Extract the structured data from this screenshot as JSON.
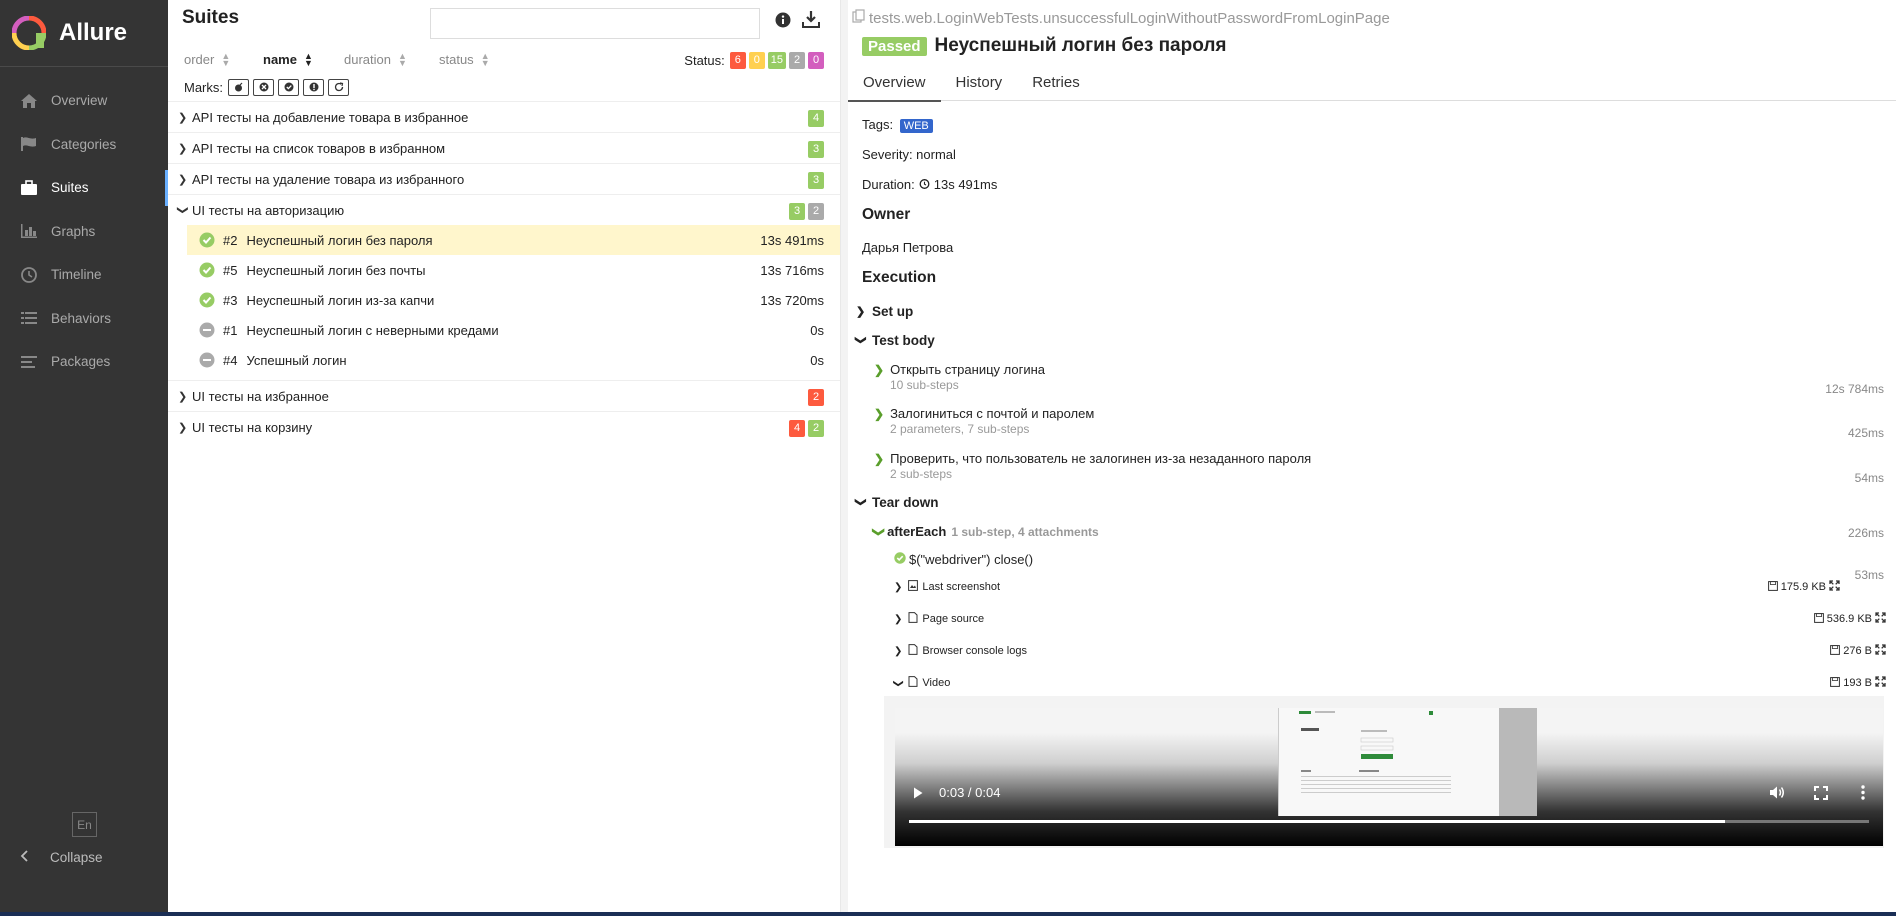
{
  "app": {
    "name": "Allure",
    "language_button": "En",
    "collapse_label": "Collapse"
  },
  "sidebar": {
    "items": [
      {
        "label": "Overview",
        "icon": "home-icon"
      },
      {
        "label": "Categories",
        "icon": "flag-icon"
      },
      {
        "label": "Suites",
        "icon": "briefcase-icon",
        "active": true
      },
      {
        "label": "Graphs",
        "icon": "bar-chart-icon"
      },
      {
        "label": "Timeline",
        "icon": "clock-icon"
      },
      {
        "label": "Behaviors",
        "icon": "list-icon"
      },
      {
        "label": "Packages",
        "icon": "align-left-icon"
      }
    ]
  },
  "suites": {
    "title": "Suites",
    "search": {
      "value": "",
      "placeholder": ""
    },
    "sorters": [
      "order",
      "name",
      "duration",
      "status"
    ],
    "status_label": "Status:",
    "status_counts": {
      "failed": "6",
      "broken": "0",
      "passed": "15",
      "skipped": "2",
      "unknown": "0"
    },
    "marks_label": "Marks:",
    "groups": [
      {
        "name": "API тесты на добавление товара в избранное",
        "counts": [
          {
            "type": "passed",
            "value": "4"
          }
        ]
      },
      {
        "name": "API тесты на список товаров в избранном",
        "counts": [
          {
            "type": "passed",
            "value": "3"
          }
        ]
      },
      {
        "name": "API тесты на удаление товара из избранного",
        "counts": [
          {
            "type": "passed",
            "value": "3"
          }
        ]
      },
      {
        "name": "UI тесты на авторизацию",
        "counts": [
          {
            "type": "passed",
            "value": "3"
          },
          {
            "type": "skipped",
            "value": "2"
          }
        ]
      },
      {
        "name": "UI тесты на избранное",
        "counts": [
          {
            "type": "failed",
            "value": "2"
          }
        ]
      },
      {
        "name": "UI тесты на корзину",
        "counts": [
          {
            "type": "failed",
            "value": "4"
          },
          {
            "type": "passed",
            "value": "2"
          }
        ]
      }
    ],
    "tests": [
      {
        "num": "#2",
        "name": "Неуспешный логин без пароля",
        "duration": "13s 491ms",
        "status": "passed"
      },
      {
        "num": "#5",
        "name": "Неуспешный логин без почты",
        "duration": "13s 716ms",
        "status": "passed"
      },
      {
        "num": "#3",
        "name": "Неуспешный логин из-за капчи",
        "duration": "13s 720ms",
        "status": "passed"
      },
      {
        "num": "#1",
        "name": "Неуспешный логин с неверными кредами",
        "duration": "0s",
        "status": "skipped"
      },
      {
        "num": "#4",
        "name": "Успешный логин",
        "duration": "0s",
        "status": "skipped"
      }
    ]
  },
  "detail": {
    "full_name": "tests.web.LoginWebTests.unsuccessfulLoginWithoutPasswordFromLoginPage",
    "status": "Passed",
    "title": "Неуспешный логин без пароля",
    "tabs": [
      "Overview",
      "History",
      "Retries"
    ],
    "tags_label": "Tags:",
    "tag": "WEB",
    "severity": "Severity: normal",
    "duration_label": "Duration:",
    "duration": "13s 491ms",
    "owner_heading": "Owner",
    "owner": "Дарья Петрова",
    "execution_heading": "Execution",
    "setup": "Set up",
    "test_body": "Test body",
    "teardown": "Tear down",
    "steps": [
      {
        "name": "Открыть страницу логина",
        "sub": "10 sub-steps",
        "duration": "12s 784ms"
      },
      {
        "name": "Залогиниться с почтой и паролем",
        "sub": "2 parameters, 7 sub-steps",
        "duration": "425ms"
      },
      {
        "name": "Проверить, что пользователь не залогинен из-за незаданного пароля",
        "sub": "2 sub-steps",
        "duration": "54ms"
      }
    ],
    "after_each": {
      "name": "afterEach",
      "info": "1 sub-step, 4 attachments",
      "duration": "226ms"
    },
    "close_step": {
      "name": "$(\"webdriver\") close()",
      "duration": "53ms"
    },
    "attachments": [
      {
        "name": "Last screenshot",
        "size": "175.9 KB"
      },
      {
        "name": "Page source",
        "size": "536.9 KB"
      },
      {
        "name": "Browser console logs",
        "size": "276 B"
      },
      {
        "name": "Video",
        "size": "193 B"
      }
    ],
    "video": {
      "time": "0:03 / 0:04",
      "progress_fraction": 0.85
    }
  },
  "colors": {
    "passed": "#97cc64",
    "failed": "#fd5a3e",
    "broken": "#ffd050",
    "skipped": "#aaaaaa",
    "unknown": "#d35ebe",
    "sidebar": "#343434"
  }
}
